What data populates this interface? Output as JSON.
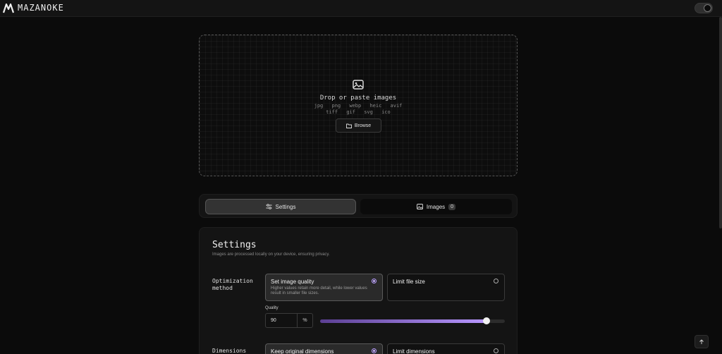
{
  "app": {
    "brand": "MAZANOKE"
  },
  "dropzone": {
    "title": "Drop or paste images",
    "formats": [
      "jpg",
      "png",
      "webp",
      "heic",
      "avif",
      "tiff",
      "gif",
      "svg",
      "ico"
    ],
    "browse_label": "Browse"
  },
  "tabs": {
    "settings_label": "Settings",
    "images_label": "Images",
    "images_count": "0"
  },
  "settings": {
    "title": "Settings",
    "subtitle": "Images are processed locally on your device, ensuring privacy.",
    "optimization": {
      "label": "Optimization method",
      "options": [
        {
          "title": "Set image quality",
          "description": "Higher values retain more detail, while lower values result in smaller file sizes.",
          "selected": true
        },
        {
          "title": "Limit file size",
          "description": "",
          "selected": false
        }
      ],
      "quality_label": "Quality",
      "quality_value": "90",
      "quality_unit": "%",
      "quality_percent": 90
    },
    "dimensions": {
      "label": "Dimensions",
      "options": [
        {
          "title": "Keep original dimensions",
          "selected": true
        },
        {
          "title": "Limit dimensions",
          "selected": false
        }
      ]
    }
  },
  "colors": {
    "accent": "#b897ff",
    "background": "#0b0b0b"
  }
}
